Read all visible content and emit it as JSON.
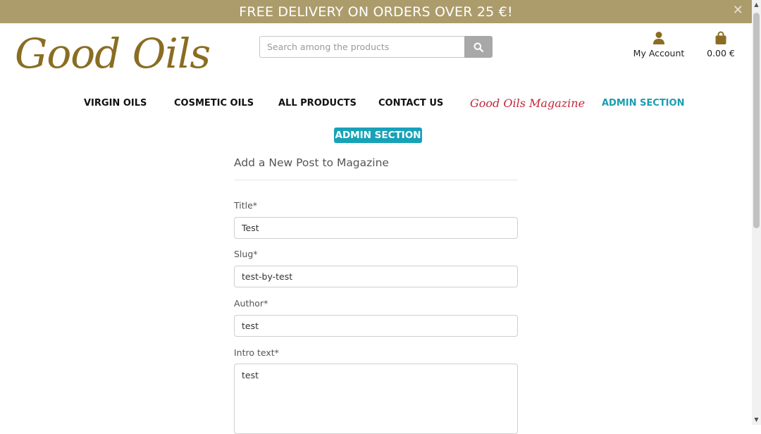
{
  "banner": {
    "text": "FREE DELIVERY ON ORDERS OVER 25 €!",
    "close_glyph": "✕"
  },
  "header": {
    "logo": "Good Oils",
    "search": {
      "placeholder": "Search among the products",
      "value": ""
    },
    "account_label": "My Account",
    "cart_total": "0.00 €"
  },
  "nav": {
    "items": [
      {
        "label": "VIRGIN OILS"
      },
      {
        "label": "COSMETIC OILS"
      },
      {
        "label": "ALL PRODUCTS"
      },
      {
        "label": "CONTACT US"
      },
      {
        "label": "Good Oils Magazine"
      },
      {
        "label": "ADMIN SECTION"
      }
    ]
  },
  "admin_badge": "ADMIN SECTION",
  "form": {
    "heading": "Add a New Post to Magazine",
    "fields": [
      {
        "label": "Title*",
        "value": "Test"
      },
      {
        "label": "Slug*",
        "value": "test-by-test"
      },
      {
        "label": "Author*",
        "value": "test"
      },
      {
        "label": "Intro text*",
        "value": "test"
      }
    ]
  },
  "colors": {
    "banner_bg": "#ac9c6c",
    "logo": "#8a6d22",
    "magazine": "#c2273a",
    "admin_accent": "#17a2b8"
  },
  "icons": [
    "close-icon",
    "search-icon",
    "user-icon",
    "shopping-bag-icon"
  ]
}
